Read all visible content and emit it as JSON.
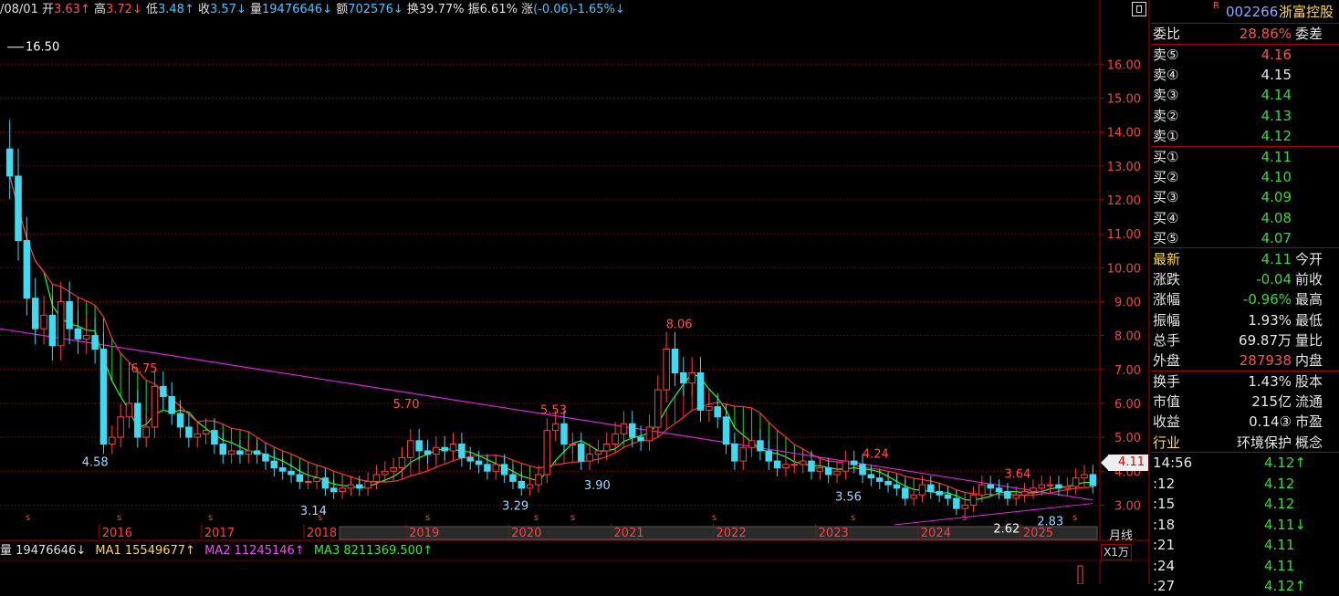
{
  "topbar": {
    "date": "/08/01",
    "open_label": "开",
    "open": "3.63↑",
    "high_label": "高",
    "high": "3.72↓",
    "low_label": "低",
    "low": "3.48↑",
    "close_label": "收",
    "close": "3.57↓",
    "vol_label": "量",
    "vol": "19476646↓",
    "amt_label": "额",
    "amt": "702576↓",
    "turn_label": "换",
    "turn": "39.77%",
    "amp_label": "振",
    "amp": "6.61%",
    "chg_label": "涨",
    "chg": "(-0.06)-1.65%↓"
  },
  "header": {
    "r_badge": "R",
    "code": "002266",
    "name": "浙富控股"
  },
  "ratio": {
    "label": "委比",
    "value": "28.86%",
    "side": "委差"
  },
  "asks": [
    {
      "label": "卖⑤",
      "price": "4.16",
      "color": "#ff5050"
    },
    {
      "label": "卖④",
      "price": "4.15",
      "color": "#e6e6e6"
    },
    {
      "label": "卖③",
      "price": "4.14",
      "color": "#33dd33"
    },
    {
      "label": "卖②",
      "price": "4.13",
      "color": "#33dd33"
    },
    {
      "label": "卖①",
      "price": "4.12",
      "color": "#33dd33"
    }
  ],
  "bids": [
    {
      "label": "买①",
      "price": "4.11",
      "color": "#33dd33"
    },
    {
      "label": "买②",
      "price": "4.10",
      "color": "#33dd33"
    },
    {
      "label": "买③",
      "price": "4.09",
      "color": "#33dd33"
    },
    {
      "label": "买④",
      "price": "4.08",
      "color": "#33dd33"
    },
    {
      "label": "买⑤",
      "price": "4.07",
      "color": "#33dd33"
    }
  ],
  "quote": [
    {
      "label": "最新",
      "value": "4.11",
      "side": "今开",
      "color": "#33dd33",
      "label_color": "#ffd84a"
    },
    {
      "label": "涨跌",
      "value": "-0.04",
      "side": "前收",
      "color": "#33dd33",
      "label_color": "#e6e6e6"
    },
    {
      "label": "涨幅",
      "value": "-0.96%",
      "side": "最高",
      "color": "#33dd33",
      "label_color": "#e6e6e6"
    },
    {
      "label": "振幅",
      "value": "1.93%",
      "side": "最低",
      "color": "#e6e6e6",
      "label_color": "#e6e6e6"
    },
    {
      "label": "总手",
      "value": "69.87万",
      "side": "量比",
      "color": "#e6e6e6",
      "label_color": "#e6e6e6"
    },
    {
      "label": "外盘",
      "value": "287938",
      "side": "内盘",
      "color": "#ff5050",
      "label_color": "#e6e6e6"
    }
  ],
  "fundamentals": [
    {
      "label": "换手",
      "value": "1.43%",
      "side": "股本",
      "color": "#e6e6e6",
      "label_color": "#e6e6e6"
    },
    {
      "label": "市值",
      "value": "215亿",
      "side": "流通",
      "color": "#e6e6e6",
      "label_color": "#e6e6e6"
    },
    {
      "label": "收益",
      "value": "0.14③",
      "side": "市盈",
      "color": "#e6e6e6",
      "label_color": "#e6e6e6"
    },
    {
      "label": "行业",
      "value": "环境保护",
      "side": "概念",
      "color": "#e6e6e6",
      "label_color": "#ffd84a"
    }
  ],
  "ticks": [
    {
      "time": "14:56",
      "price": "4.12↑",
      "color": "#33dd33"
    },
    {
      "time": ":12",
      "price": "4.12",
      "color": "#33dd33"
    },
    {
      "time": ":15",
      "price": "4.12",
      "color": "#33dd33"
    },
    {
      "time": ":18",
      "price": "4.11↓",
      "color": "#33dd33"
    },
    {
      "time": ":21",
      "price": "4.11",
      "color": "#33dd33"
    },
    {
      "time": ":24",
      "price": "4.11",
      "color": "#33dd33"
    },
    {
      "time": ":27",
      "price": "4.12↑",
      "color": "#33dd33"
    }
  ],
  "volume": {
    "vol_label": "量",
    "vol": "19476646↓",
    "ma1_label": "MA1",
    "ma1": "15549677↑",
    "ma2_label": "MA2",
    "ma2": "11245146↑",
    "ma3_label": "MA3",
    "ma3": "8211369.500↑"
  },
  "price_tag": "4.11",
  "period_label": "月线",
  "unit_label": "X1万",
  "colors": {
    "up": "#ff4040",
    "down": "#41d8f0",
    "ma_short": "#22ff22",
    "ma_mid": "#dd22dd",
    "grid": "#7a0000",
    "axis_text": "#ff4040"
  },
  "chart_data": {
    "type": "candlestick",
    "title": "",
    "xlabel": "",
    "ylabel": "",
    "ylim": [
      2.5,
      17.3
    ],
    "y_ticks": [
      "3.00",
      "4.00",
      "5.00",
      "6.00",
      "7.00",
      "8.00",
      "9.00",
      "10.00",
      "11.00",
      "12.00",
      "13.00",
      "14.00",
      "15.00",
      "16.00"
    ],
    "year_labels": [
      "2016",
      "2017",
      "2018",
      "2019",
      "2020",
      "2021",
      "2022",
      "2023",
      "2024",
      "2025"
    ],
    "annotations": [
      {
        "text": "16.50",
        "value": 16.5,
        "color": "#ffffff"
      },
      {
        "text": "4.58",
        "value": 4.58,
        "color": "#9fd8ff"
      },
      {
        "text": "6.75",
        "value": 6.75,
        "color": "#ff5050"
      },
      {
        "text": "3.14",
        "value": 3.14,
        "color": "#9fd8ff"
      },
      {
        "text": "5.70",
        "value": 5.7,
        "color": "#ff5050"
      },
      {
        "text": "3.29",
        "value": 3.29,
        "color": "#9fd8ff"
      },
      {
        "text": "5.53",
        "value": 5.53,
        "color": "#ff5050"
      },
      {
        "text": "3.90",
        "value": 3.9,
        "color": "#9fd8ff"
      },
      {
        "text": "8.06",
        "value": 8.06,
        "color": "#ff5050"
      },
      {
        "text": "3.56",
        "value": 3.56,
        "color": "#9fd8ff"
      },
      {
        "text": "4.24",
        "value": 4.24,
        "color": "#ff5050"
      },
      {
        "text": "2.62",
        "value": 2.62,
        "color": "#ffffff"
      },
      {
        "text": "3.64",
        "value": 3.64,
        "color": "#ff5050"
      },
      {
        "text": "2.83",
        "value": 2.83,
        "color": "#9fd8ff"
      }
    ],
    "year_start_index": [
      11,
      23,
      35,
      47,
      59,
      71,
      83,
      95,
      107,
      119
    ],
    "series": [
      {
        "name": "close",
        "values": [
          12.7,
          10.8,
          9.1,
          8.2,
          8.6,
          7.7,
          9.0,
          8.2,
          7.9,
          8.0,
          7.6,
          4.8,
          5.0,
          5.6,
          6.0,
          5.0,
          5.3,
          6.5,
          6.2,
          5.7,
          5.3,
          5.0,
          5.1,
          5.2,
          4.8,
          4.5,
          4.6,
          4.5,
          4.6,
          4.5,
          4.3,
          4.1,
          4.0,
          3.9,
          3.7,
          3.7,
          3.8,
          3.5,
          3.4,
          3.5,
          3.6,
          3.5,
          3.7,
          3.9,
          4.0,
          4.1,
          4.4,
          4.9,
          4.6,
          4.5,
          4.7,
          4.6,
          4.8,
          4.4,
          4.3,
          4.2,
          4.0,
          4.2,
          3.9,
          3.7,
          3.5,
          3.6,
          3.9,
          5.2,
          5.4,
          4.8,
          4.8,
          4.3,
          4.5,
          4.6,
          4.8,
          5.1,
          5.4,
          5.0,
          4.9,
          5.3,
          6.4,
          7.6,
          6.9,
          6.6,
          6.9,
          5.8,
          5.9,
          5.6,
          4.8,
          4.3,
          4.7,
          4.9,
          4.6,
          4.3,
          4.1,
          4.2,
          4.2,
          4.3,
          4.0,
          4.1,
          3.9,
          4.0,
          4.3,
          4.2,
          3.9,
          3.8,
          3.7,
          3.6,
          3.5,
          3.2,
          3.3,
          3.6,
          3.4,
          3.3,
          3.2,
          2.9,
          3.0,
          3.3,
          3.6,
          3.5,
          3.4,
          3.2,
          3.3,
          3.4,
          3.5,
          3.6,
          3.6,
          3.5,
          3.55,
          3.8,
          3.9,
          3.57
        ]
      }
    ]
  }
}
